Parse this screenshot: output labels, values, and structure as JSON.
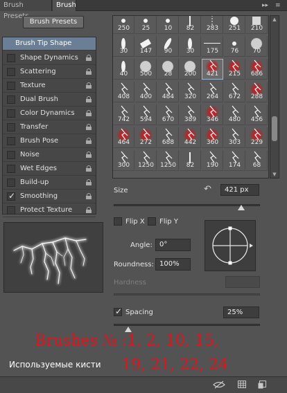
{
  "tabs": [
    {
      "label": "Brush Presets"
    },
    {
      "label": "Brush"
    }
  ],
  "tab_controls": {
    "collapse_icon": "double-chevron-right-icon",
    "menu_icon": "panel-menu-icon"
  },
  "brush_presets_button": "Brush Presets",
  "options": [
    {
      "label": "Brush Tip Shape",
      "checked": null,
      "locked": false,
      "selected": true
    },
    {
      "label": "Shape Dynamics",
      "checked": false,
      "locked": true
    },
    {
      "label": "Scattering",
      "checked": false,
      "locked": true
    },
    {
      "label": "Texture",
      "checked": false,
      "locked": true
    },
    {
      "label": "Dual Brush",
      "checked": false,
      "locked": true
    },
    {
      "label": "Color Dynamics",
      "checked": false,
      "locked": true
    },
    {
      "label": "Transfer",
      "checked": false,
      "locked": true
    },
    {
      "label": "Brush Pose",
      "checked": false,
      "locked": true
    },
    {
      "label": "Noise",
      "checked": false,
      "locked": true
    },
    {
      "label": "Wet Edges",
      "checked": false,
      "locked": true
    },
    {
      "label": "Build-up",
      "checked": false,
      "locked": true
    },
    {
      "label": "Smoothing",
      "checked": true,
      "locked": true
    },
    {
      "label": "Protect Texture",
      "checked": false,
      "locked": true
    }
  ],
  "brush_grid": {
    "rows": [
      [
        "250",
        "25",
        "10",
        "82",
        "283",
        "251",
        "210"
      ],
      [
        "30",
        "147",
        "90",
        "30",
        "175",
        "76",
        "70"
      ],
      [
        "40",
        "500",
        "28",
        "200",
        "421",
        "215",
        "686"
      ],
      [
        "408",
        "400",
        "484",
        "320",
        "264",
        "672",
        "288"
      ],
      [
        "742",
        "594",
        "670",
        "389",
        "346",
        "480",
        "456"
      ],
      [
        "464",
        "272",
        "688",
        "442",
        "360",
        "303",
        "229"
      ],
      [
        "300",
        "1250",
        "1250",
        "82",
        "190",
        "174",
        "68"
      ]
    ],
    "selected": "421",
    "highlight_color": "#d0262a"
  },
  "size": {
    "label": "Size",
    "value": "421 px",
    "slider_fraction": 0.87
  },
  "flip_x": {
    "label": "Flip X",
    "checked": false
  },
  "flip_y": {
    "label": "Flip Y",
    "checked": false
  },
  "angle": {
    "label": "Angle:",
    "value": "0°"
  },
  "roundness": {
    "label": "Roundness:",
    "value": "100%"
  },
  "hardness": {
    "label": "Hardness"
  },
  "spacing": {
    "label": "Spacing",
    "checked": true,
    "value": "25%",
    "slider_fraction": 0.1
  },
  "annotation": {
    "line1": "Brushes № :1, 2, 10, 15,",
    "line2": "19, 21, 22, 24",
    "caption": "Используемые кисти",
    "color": "#e0141e"
  },
  "bottom_icons": [
    "brush-eye-icon",
    "grid-icon",
    "new-preset-icon"
  ]
}
